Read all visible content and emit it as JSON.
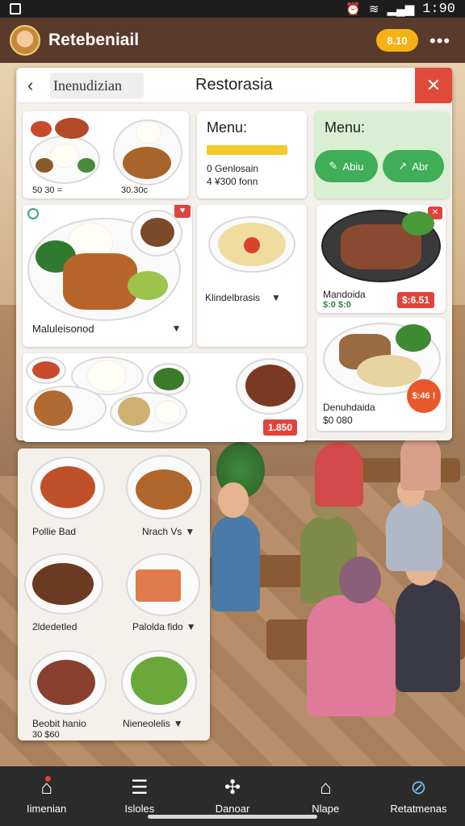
{
  "status_bar": {
    "time": "1:90"
  },
  "app_header": {
    "title": "Retebeniail",
    "pill": "8.10",
    "more_icon": "more-dots-icon"
  },
  "panel": {
    "back_icon": "chevron-left-icon",
    "search_value": "Inenudizian",
    "title": "Restorasia",
    "close_icon": "close-icon"
  },
  "cards": {
    "dish1": {
      "price_left": "50 30 =",
      "price_right": "30.30c"
    },
    "menu_card": {
      "title": "Menu:",
      "line1": "0 Genlosain",
      "line2": "4 ¥300 fonn"
    },
    "menu_green": {
      "title": "Menu:",
      "btn1": "Abiu",
      "btn2": "Abr"
    },
    "big_dish": {
      "label": "Maluleisonod"
    },
    "pasta": {
      "label": "Klindelbrasis"
    },
    "steak": {
      "label": "Mandoida",
      "price": "$:0 $:0",
      "tag": "$:6.51"
    },
    "platter": {
      "tag": "1.850"
    },
    "fish": {
      "label": "Denuhdaida",
      "price": "$0 080",
      "badge": "$:46 !"
    }
  },
  "list": [
    {
      "left": "Pollie Bad",
      "right": "Nrach Vs"
    },
    {
      "left": "2ldedetled",
      "right": "Palolda fido"
    },
    {
      "left": "Beobit hanio",
      "left_sub": "30 $60",
      "right": "Nieneolelis"
    }
  ],
  "bottom_nav": [
    {
      "label": "Iimenian",
      "icon": "home-icon"
    },
    {
      "label": "Isloles",
      "icon": "list-icon"
    },
    {
      "label": "Danoar",
      "icon": "map-icon"
    },
    {
      "label": "Nlape",
      "icon": "house-icon"
    },
    {
      "label": "Retatmenas",
      "icon": "compass-icon"
    }
  ]
}
